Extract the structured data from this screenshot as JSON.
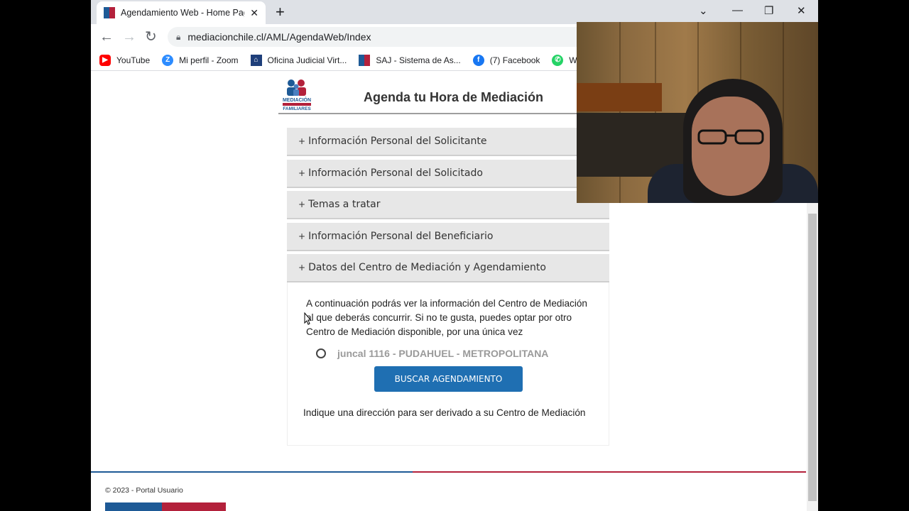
{
  "browser": {
    "tab_title": "Agendamiento Web - Home Page",
    "url": "mediacionchile.cl/AML/AgendaWeb/Index",
    "bookmarks": [
      {
        "label": "YouTube",
        "icon": "youtube-icon",
        "color": "#ff0000"
      },
      {
        "label": "Mi perfil - Zoom",
        "icon": "zoom-icon",
        "color": "#2d8cff"
      },
      {
        "label": "Oficina Judicial Virt...",
        "icon": "courthouse-icon",
        "color": "#1f3f7a"
      },
      {
        "label": "SAJ - Sistema de As...",
        "icon": "flag-icon",
        "color": "#1e5a96"
      },
      {
        "label": "(7) Facebook",
        "icon": "facebook-icon",
        "color": "#1877f2"
      },
      {
        "label": "Wha",
        "icon": "whatsapp-icon",
        "color": "#25d366"
      }
    ]
  },
  "page": {
    "title": "Agenda tu Hora de Mediación",
    "logo_text": "MEDIACIÓN FAMILIARES",
    "sections": [
      "Información Personal del Solicitante",
      "Información Personal del Solicitado",
      "Temas a tratar",
      "Información Personal del Beneficiario",
      "Datos del Centro de Mediación y Agendamiento"
    ],
    "section_prefix": "+",
    "intro": "A continuación podrás ver la información del Centro de Mediación al que deberás concurrir. Si no te gusta, puedes optar por otro Centro de Mediación disponible, por una única vez",
    "center_option": "juncal 1116 - PUDAHUEL - METROPOLITANA",
    "search_button": "BUSCAR AGENDAMIENTO",
    "hint": "Indique una dirección para ser derivado a su Centro de Mediación",
    "footer": "© 2023 - Portal Usuario"
  },
  "colors": {
    "primary_blue": "#1f6fb2",
    "flag_blue": "#1e5a96",
    "flag_red": "#b3213b",
    "accordion_bg": "#e7e7e7"
  }
}
